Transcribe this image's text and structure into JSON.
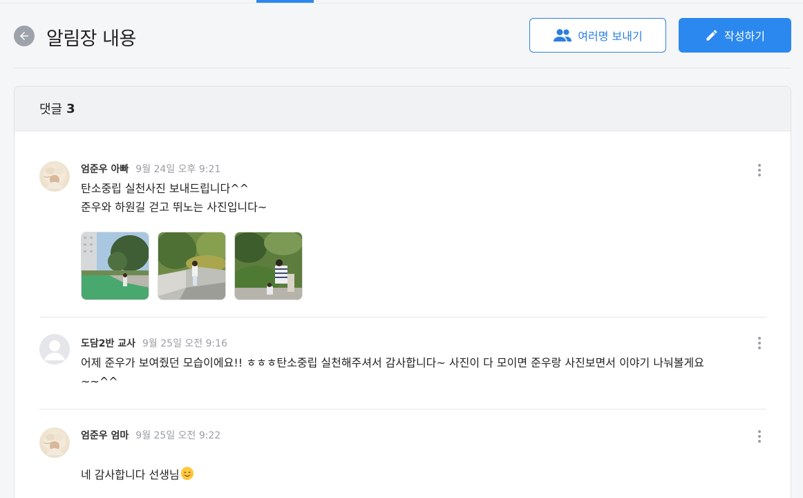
{
  "header": {
    "title": "알림장 내용",
    "multi_send_label": "여러명 보내기",
    "write_label": "작성하기"
  },
  "comments_section": {
    "label": "댓글",
    "count": "3"
  },
  "comments": [
    {
      "author": "엄준우 아빠",
      "time": "9월 24일 오후 9:21",
      "text": "탄소중립 실천사진 보내드립니다^^\n준우와 하원길 걷고 뛰노는 사진입니다~"
    },
    {
      "author": "도담2반 교사",
      "time": "9월 25일 오전 9:16",
      "text": "어제 준우가 보여줬던 모습이에요!! ㅎㅎㅎ탄소중립 실천해주셔서 감사합니다~ 사진이 다 모이면 준우랑 사진보면서 이야기 나눠볼게요\n~~^^"
    },
    {
      "author": "엄준우 엄마",
      "time": "9월 25일 오전 9:22",
      "text": "네 감사합니다 선생님"
    }
  ],
  "icons": {
    "back": "arrow-left-icon",
    "multi_send": "people-icon",
    "write": "pencil-icon",
    "more": "more-vertical-icon",
    "emoji": "smiling-face-emoji"
  },
  "colors": {
    "accent": "#2b88ee",
    "muted": "#9a9da3"
  }
}
